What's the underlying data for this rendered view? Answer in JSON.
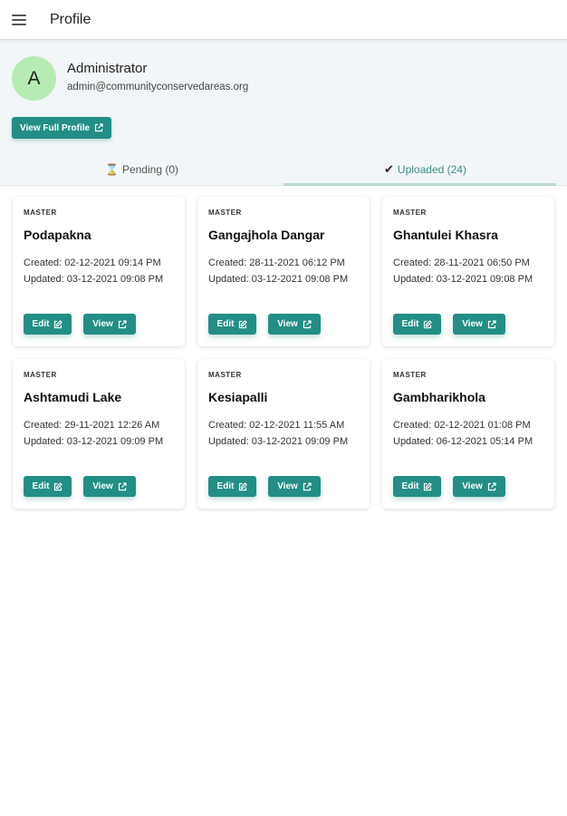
{
  "appbar": {
    "title": "Profile",
    "menu_icon": "hamburger-menu-icon"
  },
  "profile": {
    "avatar_letter": "A",
    "name": "Administrator",
    "email": "admin@communityconservedareas.org",
    "full_profile_label": "View Full Profile",
    "avatar_color": "#b6ecb4"
  },
  "tabs": [
    {
      "icon": "⌛",
      "label": "Pending (0)"
    },
    {
      "icon": "✔",
      "label": "Uploaded (24)"
    }
  ],
  "accent_color": "#228e86",
  "cards": [
    {
      "tag": "MASTER",
      "name": "Podapakna",
      "created": "Created: 02-12-2021 09:14 PM",
      "updated": "Updated: 03-12-2021 09:08 PM",
      "edit_label": "Edit",
      "view_label": "View"
    },
    {
      "tag": "MASTER",
      "name": "Gangajhola Dangar",
      "created": "Created: 28-11-2021 06:12 PM",
      "updated": "Updated: 03-12-2021 09:08 PM",
      "edit_label": "Edit",
      "view_label": "View"
    },
    {
      "tag": "MASTER",
      "name": "Ghantulei Khasra",
      "created": "Created: 28-11-2021 06:50 PM",
      "updated": "Updated: 03-12-2021 09:08 PM",
      "edit_label": "Edit",
      "view_label": "View"
    },
    {
      "tag": "MASTER",
      "name": "Ashtamudi Lake",
      "created": "Created: 29-11-2021 12:26 AM",
      "updated": "Updated: 03-12-2021 09:09 PM",
      "edit_label": "Edit",
      "view_label": "View"
    },
    {
      "tag": "MASTER",
      "name": "Kesiapalli",
      "created": "Created: 02-12-2021 11:55 AM",
      "updated": "Updated: 03-12-2021 09:09 PM",
      "edit_label": "Edit",
      "view_label": "View"
    },
    {
      "tag": "MASTER",
      "name": "Gambharikhola",
      "created": "Created: 02-12-2021 01:08 PM",
      "updated": "Updated: 06-12-2021 05:14 PM",
      "edit_label": "Edit",
      "view_label": "View"
    }
  ]
}
